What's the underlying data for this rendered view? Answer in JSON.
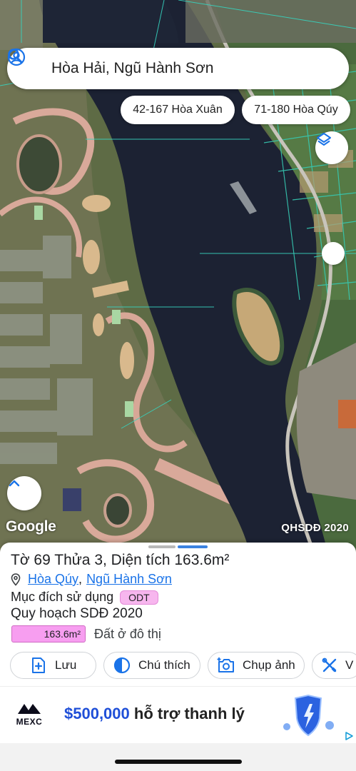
{
  "search": {
    "text": "Hòa Hải, Ngũ Hành Sơn"
  },
  "chips": [
    {
      "label": "42-167 Hòa Xuân"
    },
    {
      "label": "71-180 Hòa Qúy"
    }
  ],
  "map": {
    "google_logo": "Google",
    "watermark": "QHSDĐ 2020"
  },
  "panel": {
    "title": "Tờ 69 Thửa 3, Diện tích 163.6m²",
    "address": {
      "ward": "Hòa Qúy",
      "separator": ",",
      "district": "Ngũ Hành Sơn"
    },
    "purpose_label": "Mục đích sử dụng",
    "purpose_badge": "ODT",
    "plan_label": "Quy hoạch SDĐ 2020",
    "area_value": "163.6m²",
    "land_type": "Đất ở đô thị",
    "colors": {
      "odt": "#f7b6ee",
      "area": "#f79ef0",
      "link": "#1a73e8"
    }
  },
  "actions": [
    {
      "label": "Lưu",
      "icon": "add-note-icon"
    },
    {
      "label": "Chú thích",
      "icon": "half-circle-icon"
    },
    {
      "label": "Chụp ảnh",
      "icon": "camera-add-icon"
    },
    {
      "label": "V",
      "icon": "tools-icon"
    }
  ],
  "ad": {
    "brand": "MEXC",
    "amount": "$500,000",
    "text": " hỗ trợ thanh lý",
    "colors": {
      "amount": "#1f4fd8"
    }
  }
}
